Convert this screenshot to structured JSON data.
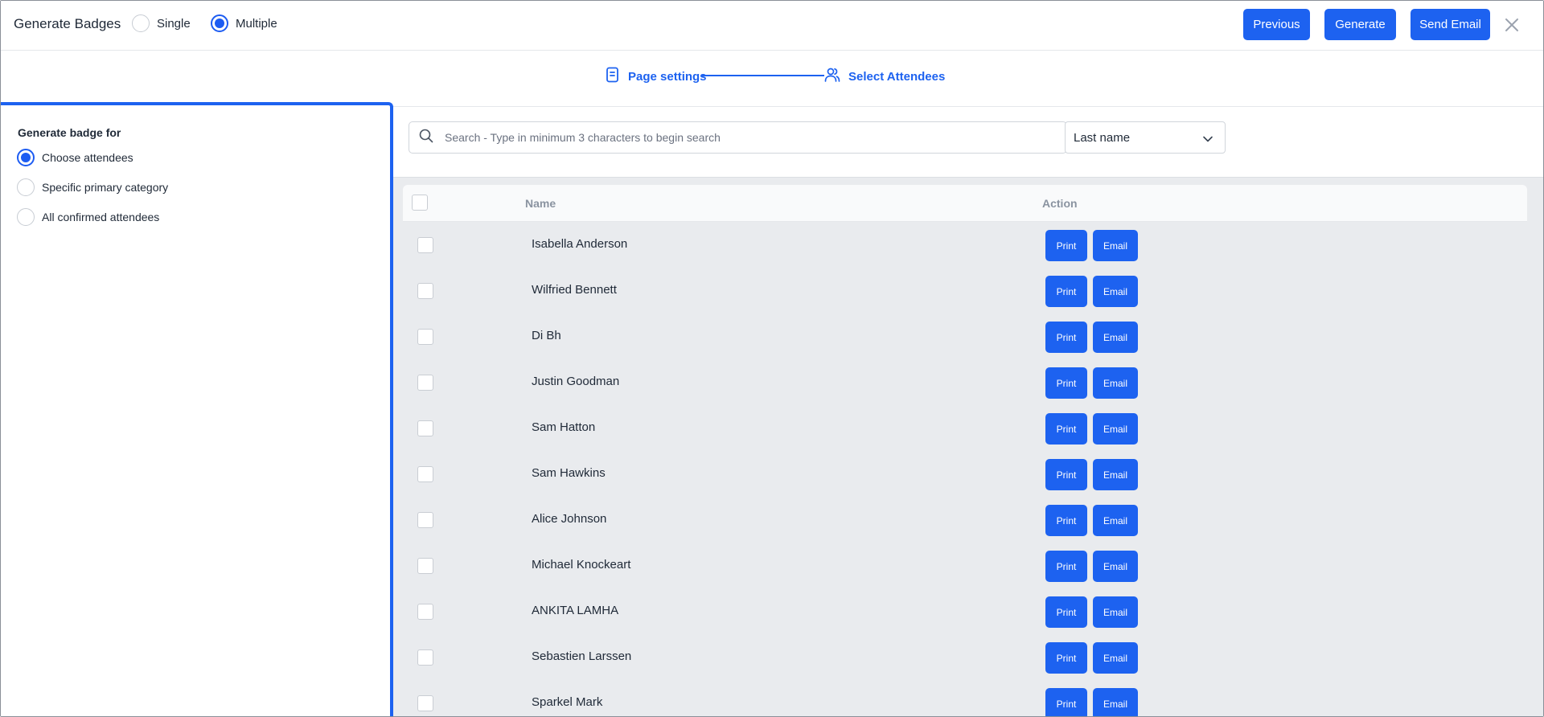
{
  "header": {
    "title": "Generate Badges",
    "mode_options": [
      {
        "label": "Single",
        "selected": false
      },
      {
        "label": "Multiple",
        "selected": true
      }
    ],
    "buttons": {
      "previous": "Previous",
      "generate": "Generate",
      "send_email": "Send Email"
    },
    "close_icon": "close-icon"
  },
  "stepper": {
    "steps": [
      {
        "label": "Page settings",
        "icon": "document-icon"
      },
      {
        "label": "Select Attendees",
        "icon": "users-icon"
      }
    ]
  },
  "left_panel": {
    "heading": "Generate badge for",
    "options": [
      {
        "label": "Choose attendees",
        "selected": true
      },
      {
        "label": "Specific primary category",
        "selected": false
      },
      {
        "label": "All confirmed attendees",
        "selected": false
      }
    ]
  },
  "search": {
    "placeholder": "Search - Type in minimum 3 characters to begin search",
    "value": ""
  },
  "sort_select": {
    "value": "Last name"
  },
  "table": {
    "columns": {
      "name": "Name",
      "action": "Action"
    },
    "print_label": "Print",
    "email_label": "Email",
    "rows": [
      {
        "name": "Isabella Anderson"
      },
      {
        "name": "Wilfried Bennett"
      },
      {
        "name": "Di Bh"
      },
      {
        "name": "Justin Goodman"
      },
      {
        "name": "Sam Hatton"
      },
      {
        "name": "Sam Hawkins"
      },
      {
        "name": "Alice Johnson"
      },
      {
        "name": "Michael Knockeart"
      },
      {
        "name": "ANKITA LAMHA"
      },
      {
        "name": "Sebastien Larssen"
      },
      {
        "name": "Sparkel Mark"
      }
    ]
  },
  "colors": {
    "accent": "#1d62f0",
    "table_bg": "#e9ebee"
  }
}
